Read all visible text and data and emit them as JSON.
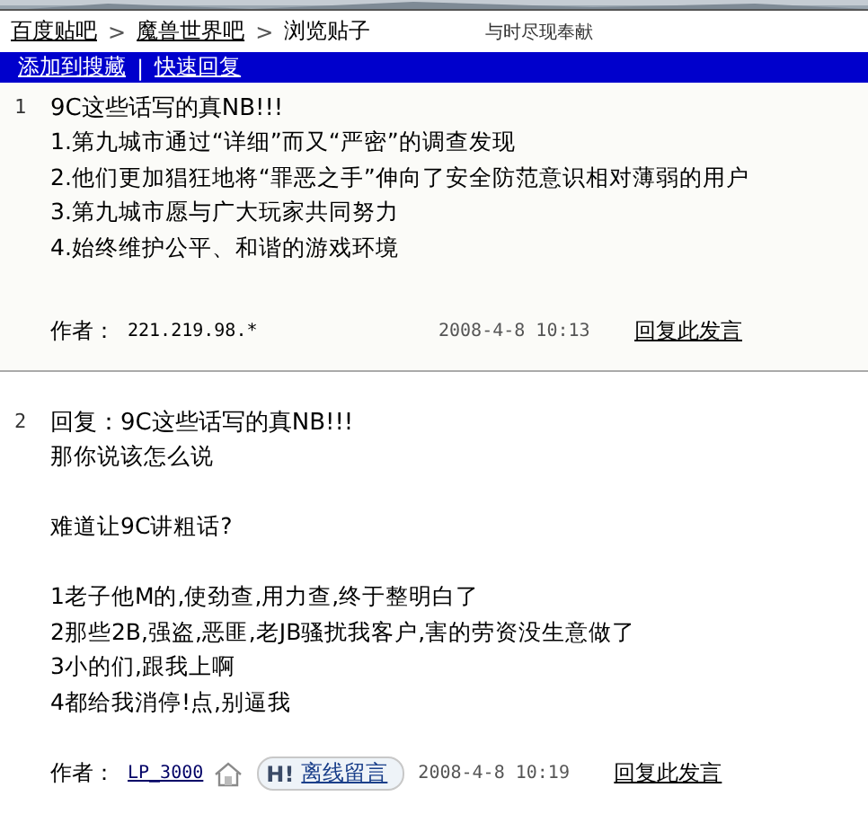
{
  "breadcrumb": {
    "items": [
      "百度贴吧",
      "魔兽世界吧",
      "浏览贴子"
    ],
    "separator": ">",
    "tagline": "与时尽现奉献"
  },
  "toolbar": {
    "links": [
      "添加到搜藏",
      "快速回复"
    ],
    "separator": "|"
  },
  "posts": [
    {
      "number": "1",
      "title": "9C这些话写的真NB!!!",
      "paragraphs": [
        [
          "1.第九城市通过“详细”而又“严密”的调查发现",
          "2.他们更加猖狂地将“罪恶之手”伸向了安全防范意识相对薄弱的用户",
          "3.第九城市愿与广大玩家共同努力",
          "4.始终维护公平、和谐的游戏环境"
        ]
      ],
      "author_label": "作者：",
      "author": "221.219.98.*",
      "author_is_link": false,
      "home_icon": false,
      "date": "2008-4-8 10:13",
      "reply_link": "回复此发言"
    },
    {
      "number": "2",
      "title": "回复：9C这些话写的真NB!!!",
      "paragraphs": [
        [
          "那你说该怎么说"
        ],
        [
          "难道让9C讲粗话?"
        ],
        [
          "1老子他M的,使劲查,用力查,终于整明白了",
          "2那些2B,强盗,恶匪,老JB骚扰我客户,害的劳资没生意做了",
          "3小的们,跟我上啊",
          "4都给我消停!点,别逼我"
        ]
      ],
      "author_label": "作者：",
      "author": "LP_3000",
      "author_is_link": true,
      "home_icon": true,
      "message_button": {
        "badge": "H!",
        "label": "离线留言"
      },
      "date": "2008-4-8 10:19",
      "reply_link": "回复此发言"
    }
  ]
}
